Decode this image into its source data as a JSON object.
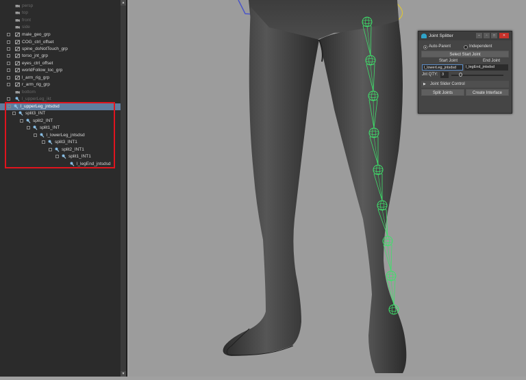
{
  "outliner": {
    "items": [
      {
        "label": "persp",
        "dim": true
      },
      {
        "label": "top",
        "dim": true
      },
      {
        "label": "front",
        "dim": true
      },
      {
        "label": "side",
        "dim": true
      },
      {
        "label": "male_geo_grp",
        "dim": false
      },
      {
        "label": "COG_ctrl_offset",
        "dim": false
      },
      {
        "label": "spine_doNotTouch_grp",
        "dim": false
      },
      {
        "label": "torso_jnt_grp",
        "dim": false
      },
      {
        "label": "eyes_ctrl_offset",
        "dim": false
      },
      {
        "label": "worldFollow_loc_grp",
        "dim": false
      },
      {
        "label": "l_arm_rig_grp",
        "dim": false
      },
      {
        "label": "r_arm_rig_grp",
        "dim": false
      },
      {
        "label": "bottom",
        "dim": true
      },
      {
        "label": "l_upperLeg_ikt",
        "dim": true
      },
      {
        "label": "l_upperLeg_jntsdsd",
        "dim": false,
        "selected": true
      },
      {
        "label": "split3_INT",
        "dim": false
      },
      {
        "label": "split2_INT",
        "dim": false
      },
      {
        "label": "split1_INT",
        "dim": false
      },
      {
        "label": "l_lowerLeg_jntsdsd",
        "dim": false
      },
      {
        "label": "split3_INT1",
        "dim": false
      },
      {
        "label": "split2_INT1",
        "dim": false
      },
      {
        "label": "split1_INT1",
        "dim": false
      },
      {
        "label": "l_legEnd_jntsdsd",
        "dim": false
      }
    ]
  },
  "joint_splitter": {
    "title": "Joint Splitter",
    "auto_parent_label": "Auto-Parent",
    "independent_label": "Independent",
    "select_start_label": "Select Start Joint",
    "start_joint_label": "Start Joint",
    "end_joint_label": "End Joint",
    "start_joint_value": "l_lowerLeg_jntsdsd",
    "end_joint_value": "l_legEnd_jntsdsd",
    "jnt_qty_label": "Jnt QTY:",
    "jnt_qty_value": "3",
    "slider_section_label": "Joint Slider Control",
    "split_button_label": "Split Joints",
    "create_button_label": "Create Interface",
    "close_glyph": "✕",
    "min_glyph": "–",
    "max_glyph": "□",
    "restore_glyph": "▫"
  },
  "colors": {
    "joint": "#3fe06b",
    "selection_outline": "#e0141e",
    "selected_row": "#5f7d9f"
  }
}
